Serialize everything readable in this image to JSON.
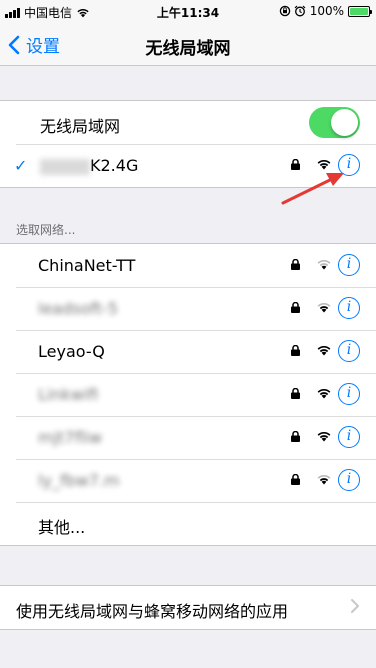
{
  "status_bar": {
    "carrier": "中国电信",
    "time": "上午11:34",
    "battery": "100%"
  },
  "nav": {
    "back_label": "设置",
    "title": "无线局域网"
  },
  "wifi_section": {
    "toggle_label": "无线局域网",
    "toggle_on": true,
    "connected_network": "K2.4G"
  },
  "choose_network_header": "选取网络...",
  "networks": [
    {
      "name": "ChinaNet-TT",
      "locked": true
    },
    {
      "name": "leadsoft-5",
      "locked": true
    },
    {
      "name": "Leyao-Q",
      "locked": true
    },
    {
      "name": "Linkwifi",
      "locked": true
    },
    {
      "name": "mjt7fliw",
      "locked": true
    },
    {
      "name": "ly_fbw7.m",
      "locked": true
    }
  ],
  "other_label": "其他...",
  "apps_row_label": "使用无线局域网与蜂窝移动网络的应用",
  "colors": {
    "accent": "#007aff",
    "toggle_on": "#4cd964",
    "annotation_arrow": "#e53935"
  }
}
